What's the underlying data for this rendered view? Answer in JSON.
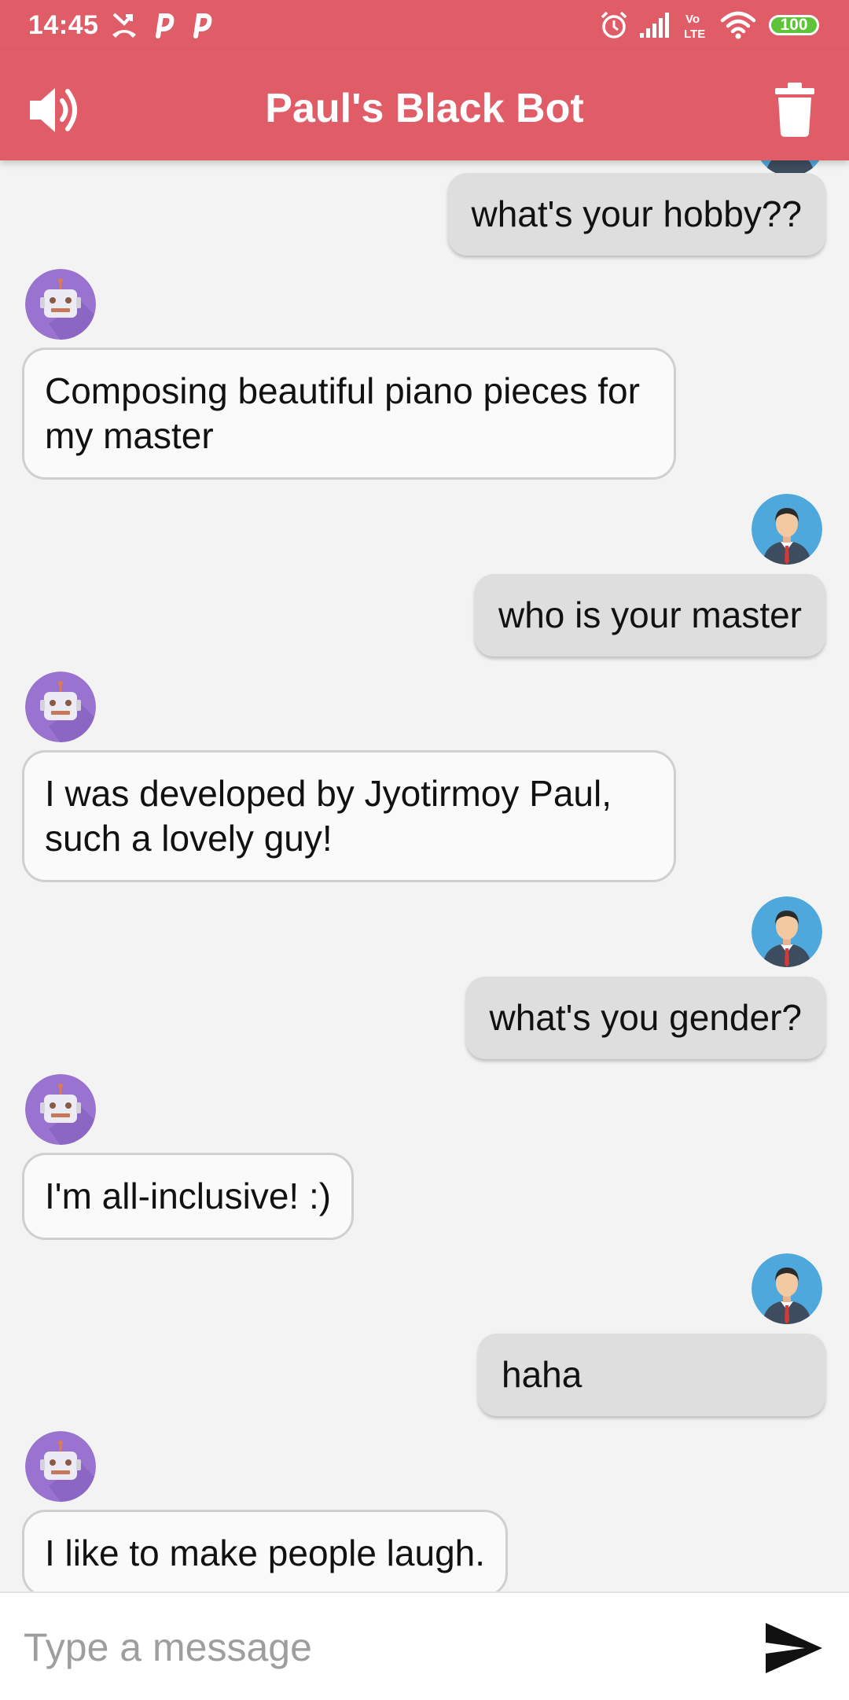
{
  "status_bar": {
    "time": "14:45",
    "battery": "100"
  },
  "app": {
    "title": "Paul's Black Bot"
  },
  "messages": [
    {
      "sender": "user",
      "text": "what's your hobby??"
    },
    {
      "sender": "bot",
      "text": "Composing beautiful piano pieces for my master"
    },
    {
      "sender": "user",
      "text": "who is your master"
    },
    {
      "sender": "bot",
      "text": "I was developed by Jyotirmoy Paul, such a lovely guy!"
    },
    {
      "sender": "user",
      "text": "what's you gender?"
    },
    {
      "sender": "bot",
      "text": "I'm all-inclusive! :)"
    },
    {
      "sender": "user",
      "text": "haha"
    },
    {
      "sender": "bot",
      "text": "I like to make people laugh."
    }
  ],
  "input": {
    "placeholder": "Type a message",
    "value": ""
  },
  "icons": {
    "speaker": "volume-icon",
    "trash": "trash-icon",
    "send": "send-icon",
    "bot_avatar": "robot-avatar",
    "user_avatar": "businessman-avatar"
  },
  "colors": {
    "primary": "#e05c67",
    "user_bubble": "#dedede",
    "bot_bubble": "#fafafa",
    "background": "#f3f3f3",
    "bot_avatar": "#9a72cf",
    "user_avatar": "#4ea8dc"
  }
}
